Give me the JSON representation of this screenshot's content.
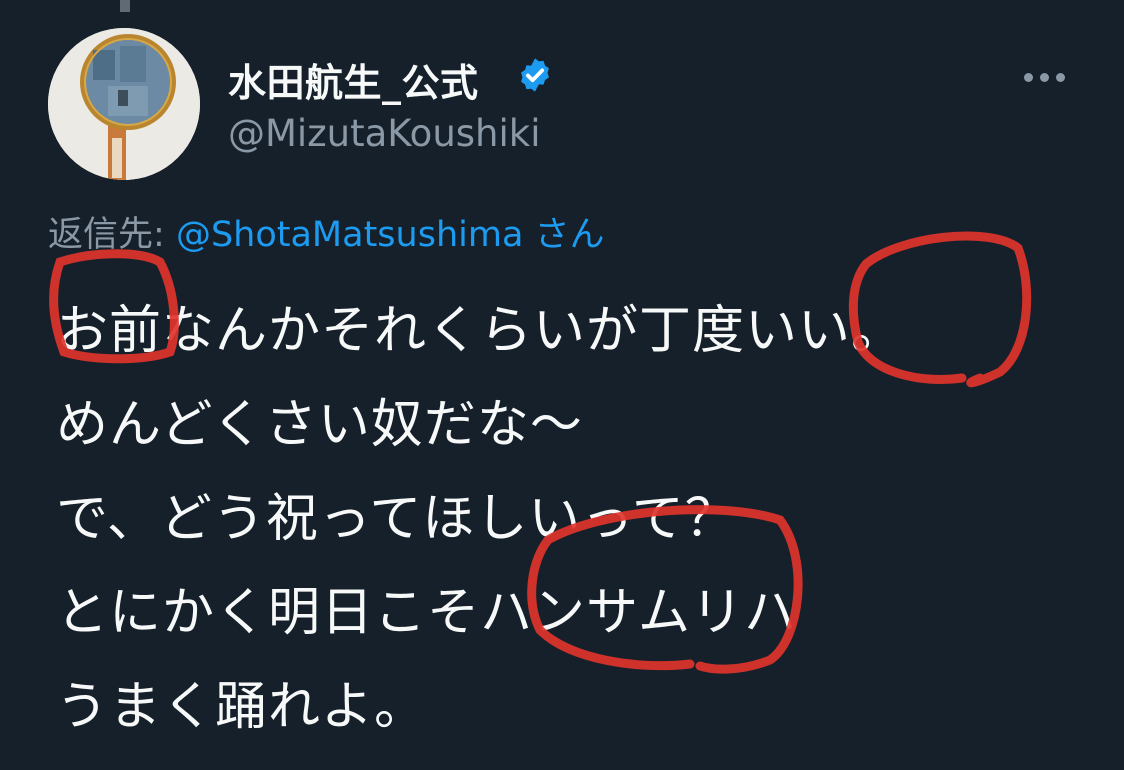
{
  "author": {
    "display_name": "水田航生_公式",
    "handle": "@MizutaKoushiki",
    "verified_icon": "verified-badge-icon",
    "avatar_icon": "magnifying-glass-photo"
  },
  "reply": {
    "prefix": "返信先:",
    "mention": "@ShotaMatsushima",
    "suffix": "さん"
  },
  "tweet": {
    "lines": [
      "お前なんかそれくらいが丁度いい。",
      "めんどくさい奴だな〜",
      "で、どう祝ってほしいって？",
      "とにかく明日こそハンサムリハ",
      "うまく踊れよ。"
    ]
  },
  "menu_icon": "more-options-icon",
  "colors": {
    "background": "#15202b",
    "text": "#f7f9f9",
    "secondary": "#8b98a5",
    "link": "#1d9bf0",
    "annotation": "#e0332b"
  }
}
